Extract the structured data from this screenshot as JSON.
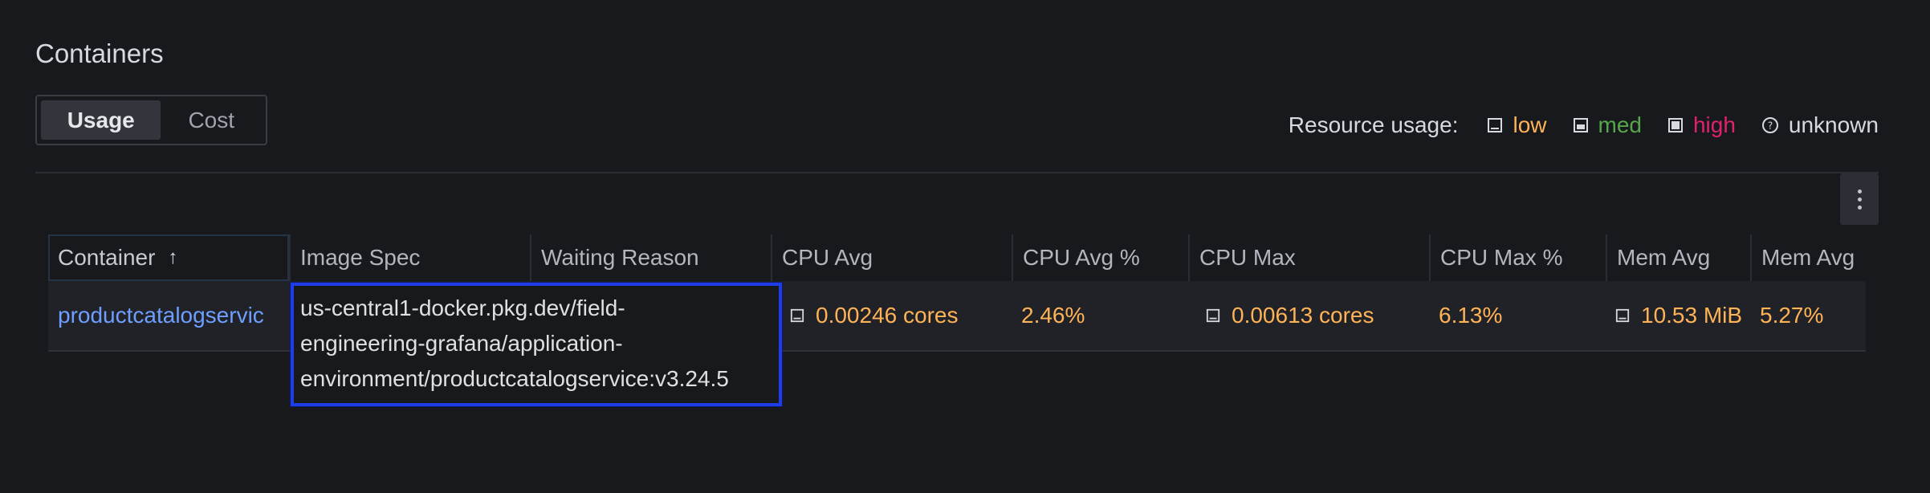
{
  "panel": {
    "title": "Containers"
  },
  "tabs": [
    {
      "label": "Usage",
      "active": true
    },
    {
      "label": "Cost",
      "active": false
    }
  ],
  "legend": {
    "label": "Resource usage:",
    "items": [
      {
        "label": "low",
        "color": "#ffb357",
        "icon": "gauge-low-icon"
      },
      {
        "label": "med",
        "color": "#56a64b",
        "icon": "gauge-med-icon"
      },
      {
        "label": "high",
        "color": "#e0226e",
        "icon": "gauge-high-icon"
      },
      {
        "label": "unknown",
        "color": "#d8d9de",
        "icon": "question-circle-icon"
      }
    ]
  },
  "table": {
    "columns": [
      "Container",
      "Image Spec",
      "Waiting Reason",
      "CPU Avg",
      "CPU Avg %",
      "CPU Max",
      "CPU Max %",
      "Mem Avg",
      "Mem Avg"
    ],
    "sort_indicator": "↑",
    "rows": [
      {
        "container": "productcatalogservic",
        "image_spec": "us-central1-docker.pkg.dev/field-engineering-grafana/application-environment/productcatalogservice:v3.24.5",
        "waiting_reason": "",
        "cpu_avg": "0.00246 cores",
        "cpu_avg_pct": "2.46%",
        "cpu_max": "0.00613 cores",
        "cpu_max_pct": "6.13%",
        "mem_avg": "10.53 MiB",
        "mem_avg_pct": "5.27%"
      }
    ]
  },
  "tooltip": {
    "lines": [
      "us-central1-docker.pkg.dev/field-",
      "engineering-grafana/application-",
      "environment/productcatalogservice:v3.24.5"
    ]
  },
  "colors": {
    "accent_link": "#6e9fff",
    "low": "#ffb357",
    "med": "#56a64b",
    "high": "#e0226e",
    "tooltip_border": "#1f3de6"
  }
}
